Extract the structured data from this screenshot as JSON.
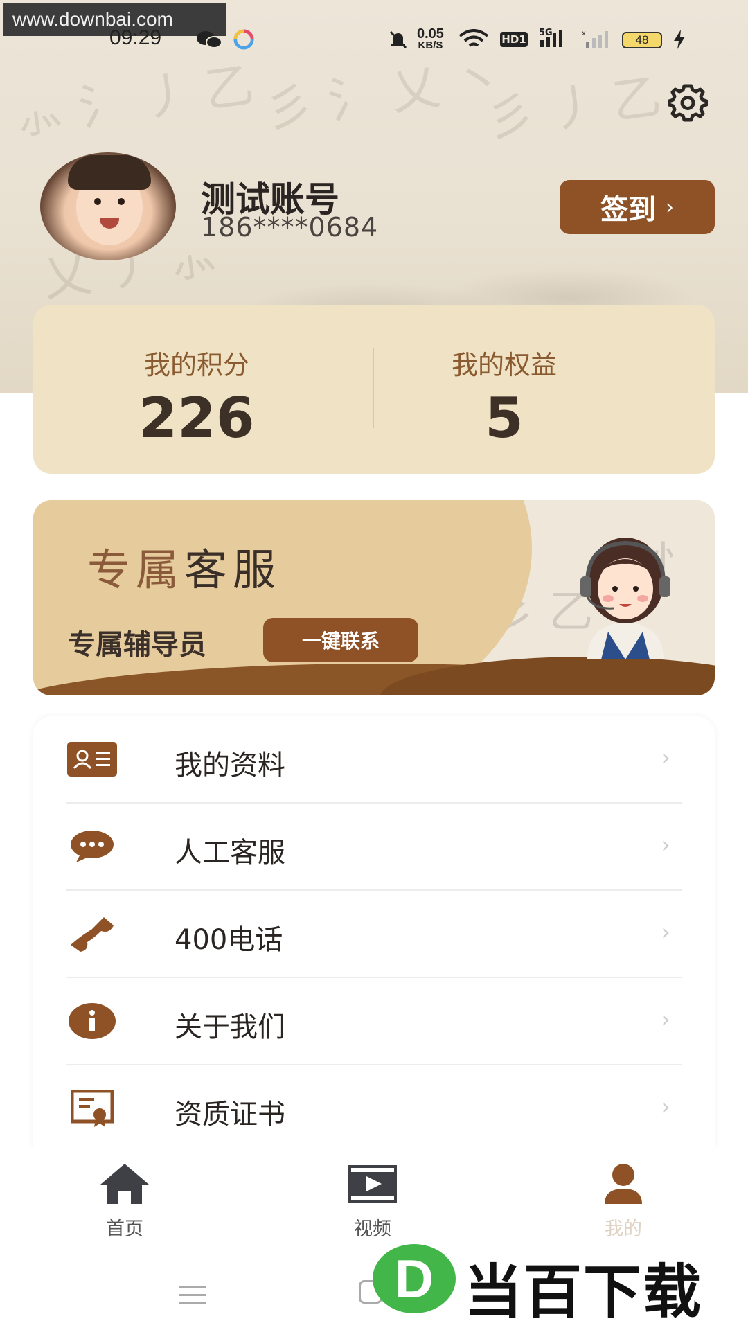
{
  "watermark": {
    "url": "www.downbai.com",
    "brand_text": "当百下载",
    "brand_logo_letter": "D"
  },
  "statusbar": {
    "time": "09:29",
    "net_speed_value": "0.05",
    "net_speed_unit": "KB/S",
    "hd_label": "HD1",
    "signal_label": "5G",
    "battery": "48"
  },
  "profile": {
    "name": "测试账号",
    "phone": "186****0684",
    "signin_label": "签到",
    "signin_chevron": "›"
  },
  "stats": {
    "points_label": "我的积分",
    "points_value": "226",
    "rights_label": "我的权益",
    "rights_value": "5"
  },
  "banner": {
    "title_part1": "专属",
    "title_part2": "客服",
    "subtitle": "专属辅导员",
    "button_label": "一键联系"
  },
  "menu": {
    "items": [
      {
        "label": "我的资料",
        "icon": "id-card-icon"
      },
      {
        "label": "人工客服",
        "icon": "chat-bubble-icon"
      },
      {
        "label": "400电话",
        "icon": "phone-icon"
      },
      {
        "label": "关于我们",
        "icon": "info-icon"
      },
      {
        "label": "资质证书",
        "icon": "certificate-icon"
      }
    ],
    "arrow": "›"
  },
  "tabbar": {
    "tabs": [
      {
        "label": "首页",
        "icon": "home-icon"
      },
      {
        "label": "视频",
        "icon": "video-icon"
      },
      {
        "label": "我的",
        "icon": "user-icon",
        "active": true
      }
    ]
  },
  "colors": {
    "accent": "#8e5226",
    "card": "#f0e2c4",
    "label_brown": "#8a5a30"
  }
}
